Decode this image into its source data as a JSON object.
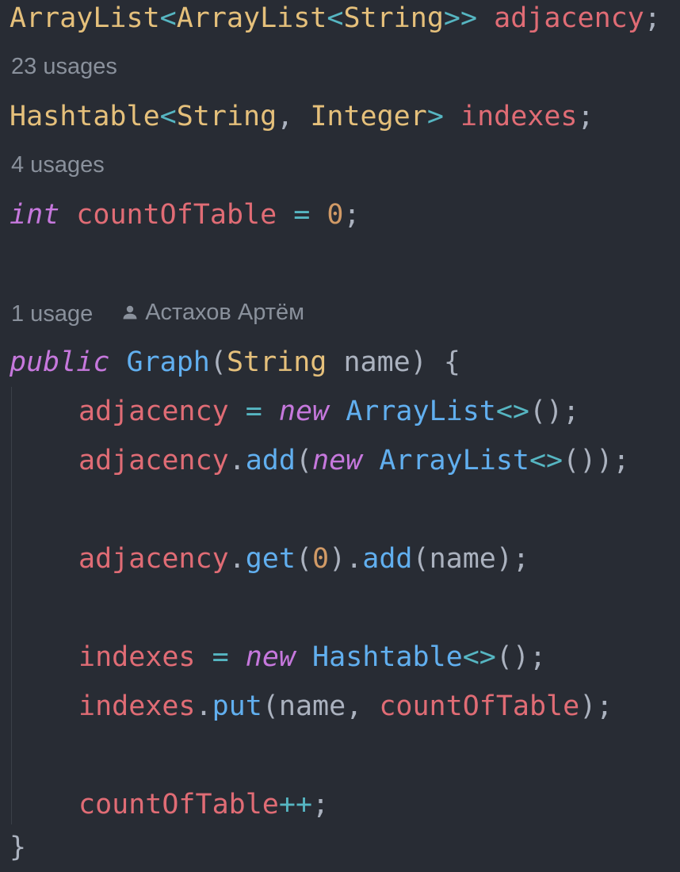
{
  "fields": {
    "adjacency": {
      "type_outer": "ArrayList",
      "lt1": "<",
      "type_inner": "ArrayList",
      "lt2": "<",
      "type_leaf": "String",
      "gt": ">>",
      "name": "adjacency",
      "semi": ";",
      "usages": "23 usages"
    },
    "indexes": {
      "type": "Hashtable",
      "lt": "<",
      "key_type": "String",
      "comma": ",",
      "value_type": "Integer",
      "gt": ">",
      "name": "indexes",
      "semi": ";",
      "usages": "4 usages"
    },
    "count": {
      "keyword": "int",
      "name": "countOfTable",
      "eq": "=",
      "value": "0",
      "semi": ";"
    }
  },
  "constructor": {
    "usages": "1 usage",
    "author": "Астахов Артём",
    "author_icon": "person-icon",
    "modifier": "public",
    "name": "Graph",
    "open_paren": "(",
    "param_type": "String",
    "param_name": "name",
    "close_sig": ")",
    "open_brace": "{",
    "close_brace": "}",
    "body": {
      "l1": {
        "target": "adjacency",
        "eq": "=",
        "kw": "new",
        "cls": "ArrayList",
        "diamond": "<>",
        "tail": "();"
      },
      "l2": {
        "target": "adjacency",
        "dot": ".",
        "method": "add",
        "open": "(",
        "kw": "new",
        "cls": "ArrayList",
        "diamond": "<>",
        "tail": "());"
      },
      "l3": {
        "target": "adjacency",
        "dot1": ".",
        "method1": "get",
        "open1": "(",
        "arg": "0",
        "close1": ")",
        "dot2": ".",
        "method2": "add",
        "open2": "(",
        "arg2": "name",
        "tail": ");"
      },
      "l4": {
        "target": "indexes",
        "eq": "=",
        "kw": "new",
        "cls": "Hashtable",
        "diamond": "<>",
        "tail": "();"
      },
      "l5": {
        "target": "indexes",
        "dot": ".",
        "method": "put",
        "open": "(",
        "arg1": "name",
        "comma": ",",
        "arg2": "countOfTable",
        "tail": ");"
      },
      "l6": {
        "target": "countOfTable",
        "op": "++",
        "semi": ";"
      }
    }
  },
  "colors": {
    "background": "#282c34",
    "type": "#e5c07b",
    "field": "#e06c75",
    "keyword": "#c678dd",
    "function": "#61afef",
    "number": "#d19a66",
    "operator": "#56b6c2",
    "hint": "#8a919c"
  }
}
